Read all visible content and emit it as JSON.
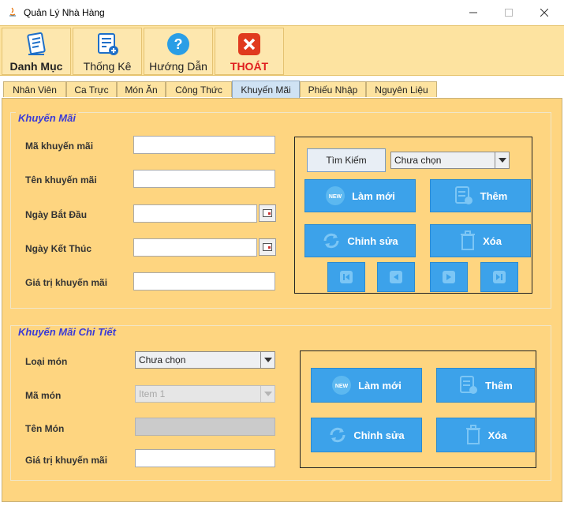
{
  "window": {
    "title": "Quản Lý Nhà Hàng"
  },
  "toolbar": {
    "buttons": [
      {
        "label": "Danh Mục",
        "icon": "list-document-icon"
      },
      {
        "label": "Thống Kê",
        "icon": "stats-list-icon"
      },
      {
        "label": "Hướng Dẫn",
        "icon": "help-icon"
      },
      {
        "label": "THOÁT",
        "icon": "exit-icon"
      }
    ]
  },
  "tabs": [
    "Nhân Viên",
    "Ca Trực",
    "Món Ăn",
    "Công Thức",
    "Khuyến Mãi",
    "Phiếu Nhập",
    "Nguyên Liệu"
  ],
  "active_tab": "Khuyến Mãi",
  "promo": {
    "title": "Khuyến Mãi",
    "labels": {
      "code": "Mã khuyến mãi",
      "name": "Tên khuyến mãi",
      "start": "Ngày Bắt Đầu",
      "end": "Ngày Kết Thúc",
      "value": "Giá trị khuyến mãi"
    },
    "values": {
      "code": "",
      "name": "",
      "start": "",
      "end": "",
      "value": ""
    },
    "search_label": "Tìm Kiếm",
    "search_option": "Chưa chọn",
    "buttons": {
      "refresh": "Làm mới",
      "add": "Thêm",
      "edit": "Chỉnh sửa",
      "delete": "Xóa"
    }
  },
  "detail": {
    "title": "Khuyến Mãi Chi Tiết",
    "labels": {
      "type": "Loại món",
      "code": "Mã món",
      "name": "Tên Món",
      "value": "Giá trị khuyến mãi"
    },
    "type_value": "Chưa chọn",
    "code_value": "Item 1",
    "name_value": "",
    "value_value": "",
    "buttons": {
      "refresh": "Làm mới",
      "add": "Thêm",
      "edit": "Chỉnh sửa",
      "delete": "Xóa"
    }
  },
  "colors": {
    "panel_bg": "#fed580",
    "button_blue": "#3ca2ea",
    "title_blue": "#3b3bd6",
    "exit_red": "#e02020"
  }
}
